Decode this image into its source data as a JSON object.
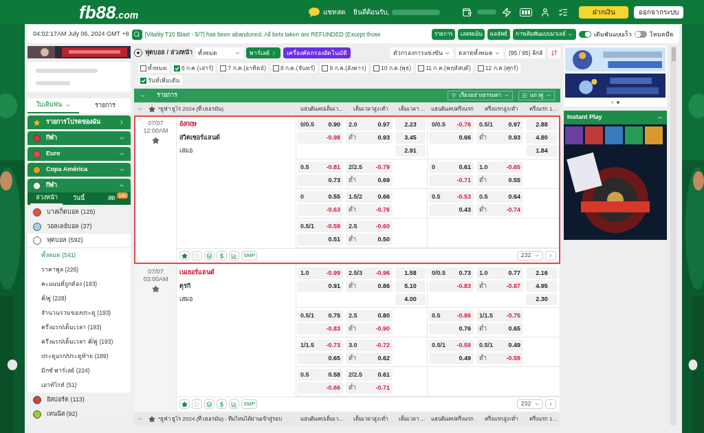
{
  "header": {
    "logo_main": "fb88",
    "logo_suffix": ".com",
    "chat": "แชทสด",
    "welcome": "ยินดีต้อนรับ,",
    "deposit": "ฝากเงิน",
    "logout": "ออกจากระบบ"
  },
  "ticker": {
    "time": "04:02:17AM July 06, 2024 GMT +8",
    "message": "[Vitality T20 Blast - 5/7] has been abandoned. All bets taken are REFUNDED (Except those",
    "buttons": [
      "รายการ",
      "เสตทเม้น",
      "ผลลัพธ์"
    ],
    "odds_type": "การเดิมพันแบบมาเลย์",
    "toggles": [
      {
        "label": "เดิมพันแบบเร็ว",
        "on": true
      },
      {
        "label": "โหมดมืด",
        "on": false
      }
    ]
  },
  "sidebar": {
    "tabs": [
      {
        "label": "ใบเดิมพัน",
        "selected": true
      },
      {
        "label": "รายการ",
        "selected": false
      }
    ],
    "sections": [
      {
        "kind": "star",
        "label": "รายการโปรดของฉัน"
      },
      {
        "kind": "sport",
        "label": "กีฬา",
        "expanded": false
      },
      {
        "kind": "trophy",
        "label": "Euro",
        "expanded": false
      },
      {
        "kind": "cup",
        "label": "Copa América",
        "expanded": false
      },
      {
        "kind": "ball",
        "label": "กีฬา",
        "expanded": true
      }
    ],
    "subtabs": [
      {
        "label": "ล่วงหน้า",
        "selected": true
      },
      {
        "label": "วันนี้",
        "selected": false
      },
      {
        "label": "สด",
        "selected": false,
        "badge": "140"
      }
    ],
    "sports": [
      {
        "kind": "basketball",
        "label": "บาสเก็ตบอล (125)",
        "expanded": false
      },
      {
        "kind": "volleyball",
        "label": "วอลเลย์บอล (37)",
        "expanded": false
      },
      {
        "kind": "football",
        "label": "ฟุตบอล (592)",
        "expanded": true,
        "children": [
          {
            "label": "ทั้งหมด (541)",
            "selected": true
          },
          {
            "label": "ราคาพูล (226)",
            "selected": false
          },
          {
            "label": "คะแนนที่ถูกต้อง (193)",
            "selected": false
          },
          {
            "label": "คี่/คู่ (228)",
            "selected": false
          },
          {
            "label": "จำนวนรวมของประตู (193)",
            "selected": false
          },
          {
            "label": "ครึ่งแรก/เต็มเวลา (193)",
            "selected": false
          },
          {
            "label": "ครึ่งแรก/เต็มเวลา คี่/คู่ (193)",
            "selected": false
          },
          {
            "label": "ประตูแรก/ประตูท้าย (189)",
            "selected": false
          },
          {
            "label": "มิกซ์ พาร์เลย์ (224)",
            "selected": false
          },
          {
            "label": "เอาท์ไรท์ (51)",
            "selected": false
          }
        ]
      },
      {
        "kind": "esports",
        "label": "อีสปอร์ต (113)",
        "expanded": false
      },
      {
        "kind": "tennis",
        "label": "เทนนิส (92)",
        "expanded": false
      }
    ]
  },
  "toolbar": {
    "title": "ฟุตบอล / ล่วงหน้า",
    "select": "ทั้งหมด",
    "parlay": "พาร์เลย์",
    "auto_filter": "เครื่องคัดกรองอัตโนมัติ",
    "match_filter": "ตัวกรองการแข่งขัน",
    "markets": "ตลาดทั้งหมด",
    "leagues": "(95 / 95) ลีกส์"
  },
  "dates": [
    {
      "label": "ทั้งหมด",
      "checked": false
    },
    {
      "label": "6 ก.ค.(เสาร์)",
      "checked": true
    },
    {
      "label": "7 ก.ค.(อาทิตย์)",
      "checked": false
    },
    {
      "label": "8 ก.ค.(จันทร์)",
      "checked": false
    },
    {
      "label": "9 ก.ค.(อังคาร)",
      "checked": false
    },
    {
      "label": "10 ก.ค.(พุธ)",
      "checked": false
    },
    {
      "label": "11 ก.ค.(พฤหัสบดี)",
      "checked": false
    },
    {
      "label": "12 ก.ค.(ศุกร์)",
      "checked": false
    },
    {
      "label": "วันที่เพิ่มเติม",
      "checked": true
    }
  ],
  "list_bar": {
    "title": "รายการ",
    "sort": "เรียงอย่างธรรมดา",
    "rows": "แถวคู่"
  },
  "leagues": [
    {
      "name": "*ยูฟ่า ยูโร 2024 (ที่ เยอรมัน)",
      "columns": [
        "แฮนดิแคปเต็มเว...",
        "เต็มเวลาสูง/ต่ำ",
        "เต็มเวลา ...",
        "แฮนดิแคปครึ่งแรก",
        "ครึ่งแรกสูง/ต่ำ",
        "ครึ่งแรก 1..."
      ],
      "matches": [
        {
          "date": "07/07",
          "time": "12:00AM",
          "home": "อังกฤษ",
          "away": "สวิตเซอร์แลนด์",
          "draw": "เสมอ",
          "selected": true,
          "smp": "SMP",
          "count": "232",
          "lines": [
            {
              "ft_hdp": [
                "0/0.5",
                "0.90",
                "-0.98"
              ],
              "ft_ou": [
                "2.0",
                "0.97",
                "ต่ำ",
                "0.93"
              ],
              "ft_1x2": [
                "2.23",
                "3.45",
                "2.91"
              ],
              "fh_hdp": [
                "0/0.5",
                "-0.76",
                "0.66"
              ],
              "fh_ou": [
                "0.5/1",
                "0.97",
                "ต่ำ",
                "0.93"
              ],
              "fh_1x2": [
                "2.88",
                "4.80",
                "1.84"
              ]
            },
            {
              "ft_hdp": [
                "0.5",
                "-0.81",
                "0.73"
              ],
              "ft_ou": [
                "2/2.5",
                "-0.79",
                "ต่ำ",
                "0.69"
              ],
              "fh_hdp": [
                "0",
                "0.61",
                "-0.71"
              ],
              "fh_ou": [
                "1.0",
                "-0.65",
                "ต่ำ",
                "0.55"
              ]
            },
            {
              "ft_hdp": [
                "0",
                "0.55",
                "-0.63"
              ],
              "ft_ou": [
                "1.5/2",
                "0.66",
                "ต่ำ",
                "-0.76"
              ],
              "fh_hdp": [
                "0.5",
                "-0.53",
                "0.43"
              ],
              "fh_ou": [
                "0.5",
                "0.64",
                "ต่ำ",
                "-0.74"
              ]
            },
            {
              "ft_hdp": [
                "0.5/1",
                "-0.59",
                "0.51"
              ],
              "ft_ou": [
                "2.5",
                "-0.60",
                "ต่ำ",
                "0.50"
              ]
            }
          ]
        },
        {
          "date": "07/07",
          "time": "03:00AM",
          "home": "เนเธอร์แลนด์",
          "away": "ตุรกี",
          "draw": "เสมอ",
          "selected": false,
          "smp": "SMP",
          "count": "232",
          "lines": [
            {
              "ft_hdp": [
                "1.0",
                "-0.99",
                "0.91"
              ],
              "ft_ou": [
                "2.5/3",
                "-0.96",
                "ต่ำ",
                "0.86"
              ],
              "ft_1x2": [
                "1.58",
                "5.10",
                "4.00"
              ],
              "fh_hdp": [
                "0/0.5",
                "0.73",
                "-0.83"
              ],
              "fh_ou": [
                "1.0",
                "0.77",
                "ต่ำ",
                "-0.87"
              ],
              "fh_1x2": [
                "2.16",
                "4.95",
                "2.30"
              ]
            },
            {
              "ft_hdp": [
                "0.5/1",
                "0.75",
                "-0.83"
              ],
              "ft_ou": [
                "2.5",
                "0.80",
                "ต่ำ",
                "-0.90"
              ],
              "fh_hdp": [
                "0.5",
                "-0.86",
                "0.76"
              ],
              "fh_ou": [
                "1/1.5",
                "-0.75",
                "ต่ำ",
                "0.65"
              ]
            },
            {
              "ft_hdp": [
                "1/1.5",
                "-0.73",
                "0.65"
              ],
              "ft_ou": [
                "3.0",
                "-0.72",
                "ต่ำ",
                "0.62"
              ],
              "fh_hdp": [
                "0.5/1",
                "-0.59",
                "0.49"
              ],
              "fh_ou": [
                "0.5/1",
                "0.49",
                "ต่ำ",
                "-0.59"
              ]
            },
            {
              "ft_hdp": [
                "0.5",
                "0.58",
                "-0.66"
              ],
              "ft_ou": [
                "2/2.5",
                "0.61",
                "ต่ำ",
                "-0.71"
              ]
            }
          ]
        }
      ]
    },
    {
      "name": "*ยูฟ่า ยูโร 2024 (ที่ เยอรมัน) - ทีมไหนได้ผ่านเข้าสู่รอบ",
      "columns": [
        "แฮนดิแคปเต็มเว...",
        "เต็มเวลาสูง/ต่ำ",
        "เต็มเวลา ...",
        "แฮนดิแคปครึ่งแรก",
        "ครึ่งแรกสูง/ต่ำ",
        "ครึ่งแรก 1..."
      ]
    }
  ],
  "promo": {
    "dots": [
      {
        "selected": false
      },
      {
        "selected": true
      }
    ],
    "instant_play": "Instant Play"
  }
}
